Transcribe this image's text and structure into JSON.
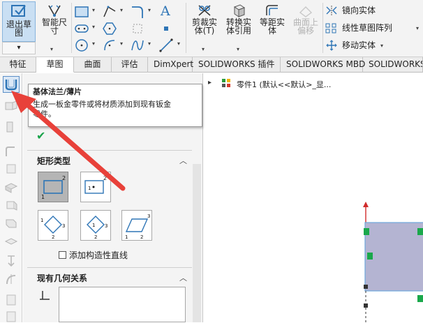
{
  "ribbon": {
    "exit_sketch": "退出草图",
    "smart_dim_line1": "智能尺",
    "smart_dim_line2": "寸",
    "trim_line1": "剪裁实",
    "trim_line2": "体(T)",
    "convert_line1": "转换实",
    "convert_line2": "体引用",
    "offset_line1": "等距实",
    "offset_line2": "体",
    "surface_offset_line1": "曲面上",
    "surface_offset_line2": "偏移",
    "mirror": "镜向实体",
    "linear_pattern": "线性草图阵列",
    "move": "移动实体"
  },
  "tabs": [
    {
      "label": "特征"
    },
    {
      "label": "草图"
    },
    {
      "label": "曲面"
    },
    {
      "label": "评估"
    },
    {
      "label": "DimXpert"
    },
    {
      "label": "SOLIDWORKS 插件"
    },
    {
      "label": "SOLIDWORKS MBD"
    },
    {
      "label": "SOLIDWORKS C"
    }
  ],
  "tooltip": {
    "title": "基体法兰/薄片",
    "text": "生成一板金零件或将材质添加到现有钣金零件。"
  },
  "panel": {
    "help": "?",
    "ok": "✔",
    "rect_type_title": "矩形类型",
    "construction_label": "添加构造性直线",
    "relations_title": "现有几何关系"
  },
  "tree": {
    "expand": "▸",
    "part_label": "零件1 (默认<<默认>_显..."
  },
  "colors": {
    "accent": "#2e75b6",
    "arrow": "#e8413a",
    "sketch_fill": "#b4b4d2",
    "sketch_border": "#6fa8dc",
    "point_green": "#1aa84b"
  }
}
